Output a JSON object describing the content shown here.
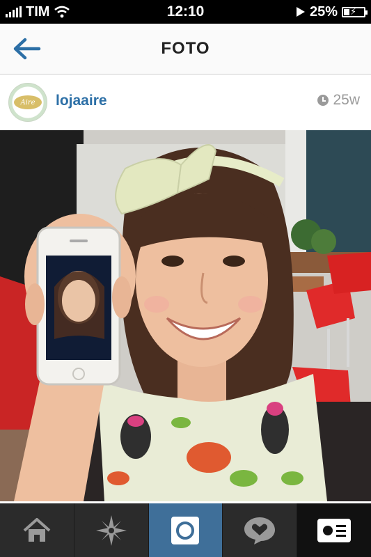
{
  "status_bar": {
    "carrier": "TIM",
    "time": "12:10",
    "battery": "25%"
  },
  "header": {
    "title": "FOTO",
    "back_icon": "back-arrow-icon"
  },
  "post": {
    "username": "lojaaire",
    "avatar_text": "Aire",
    "age": "25w"
  },
  "tabs": [
    {
      "name": "home",
      "icon": "home-icon"
    },
    {
      "name": "explore",
      "icon": "explore-star-icon"
    },
    {
      "name": "camera",
      "icon": "camera-icon",
      "active": true
    },
    {
      "name": "activity",
      "icon": "heart-bubble-icon"
    },
    {
      "name": "profile",
      "icon": "profile-card-icon"
    }
  ],
  "colors": {
    "link_blue": "#2c6fa6",
    "active_tab": "#3f6f99",
    "tab_bar": "#2b2b2b"
  }
}
